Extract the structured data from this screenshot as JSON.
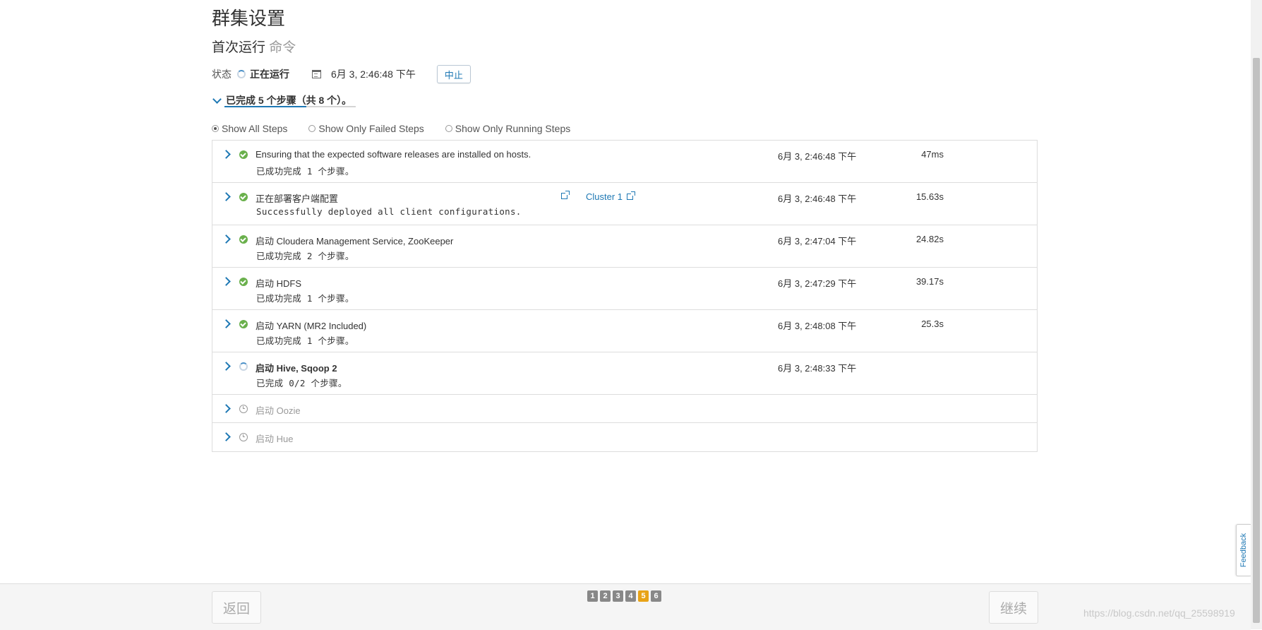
{
  "header": {
    "title": "群集设置",
    "subtitle_main": "首次运行",
    "subtitle_muted": "命令"
  },
  "status": {
    "label": "状态",
    "value": "正在运行",
    "datetime": "6月 3, 2:46:48 下午",
    "abort_label": "中止"
  },
  "progress": {
    "summary": "已完成 5 个步骤（共 8 个）。",
    "completed": 5,
    "total": 8
  },
  "filters": [
    {
      "label": "Show All Steps",
      "selected": true
    },
    {
      "label": "Show Only Failed Steps",
      "selected": false
    },
    {
      "label": "Show Only Running Steps",
      "selected": false
    }
  ],
  "steps": [
    {
      "status": "success",
      "name": "Ensuring that the expected software releases are installed on hosts.",
      "detail": "已成功完成 1 个步骤。",
      "time": "6月 3, 2:46:48 下午",
      "duration": "47ms"
    },
    {
      "status": "success",
      "name": "正在部署客户端配置",
      "detail": "Successfully deployed all client configurations.",
      "time": "6月 3, 2:46:48 下午",
      "duration": "15.63s",
      "link_label": "Cluster 1"
    },
    {
      "status": "success",
      "name": "启动 Cloudera Management Service, ZooKeeper",
      "detail": "已成功完成 2 个步骤。",
      "time": "6月 3, 2:47:04 下午",
      "duration": "24.82s"
    },
    {
      "status": "success",
      "name": "启动 HDFS",
      "detail": "已成功完成 1 个步骤。",
      "time": "6月 3, 2:47:29 下午",
      "duration": "39.17s"
    },
    {
      "status": "success",
      "name": "启动 YARN (MR2 Included)",
      "detail": "已成功完成 1 个步骤。",
      "time": "6月 3, 2:48:08 下午",
      "duration": "25.3s"
    },
    {
      "status": "running",
      "name": "启动 Hive, Sqoop 2",
      "detail": "已完成 0/2 个步骤。",
      "time": "6月 3, 2:48:33 下午",
      "duration": ""
    },
    {
      "status": "pending",
      "name": "启动 Oozie"
    },
    {
      "status": "pending",
      "name": "启动 Hue"
    }
  ],
  "footer": {
    "back_label": "返回",
    "next_label": "继续",
    "pages": [
      "1",
      "2",
      "3",
      "4",
      "5",
      "6"
    ],
    "active_page": "5"
  },
  "feedback_label": "Feedback",
  "watermark": "https://blog.csdn.net/qq_25598919",
  "colors": {
    "accent": "#1e78b4",
    "success": "#6ab04c",
    "active_page": "#e8a317"
  },
  "icons": {
    "status_running": "spinner-icon",
    "date": "calendar-icon",
    "step_success": "check-circle-icon",
    "step_pending": "clock-icon",
    "external_link": "external-link-icon"
  }
}
